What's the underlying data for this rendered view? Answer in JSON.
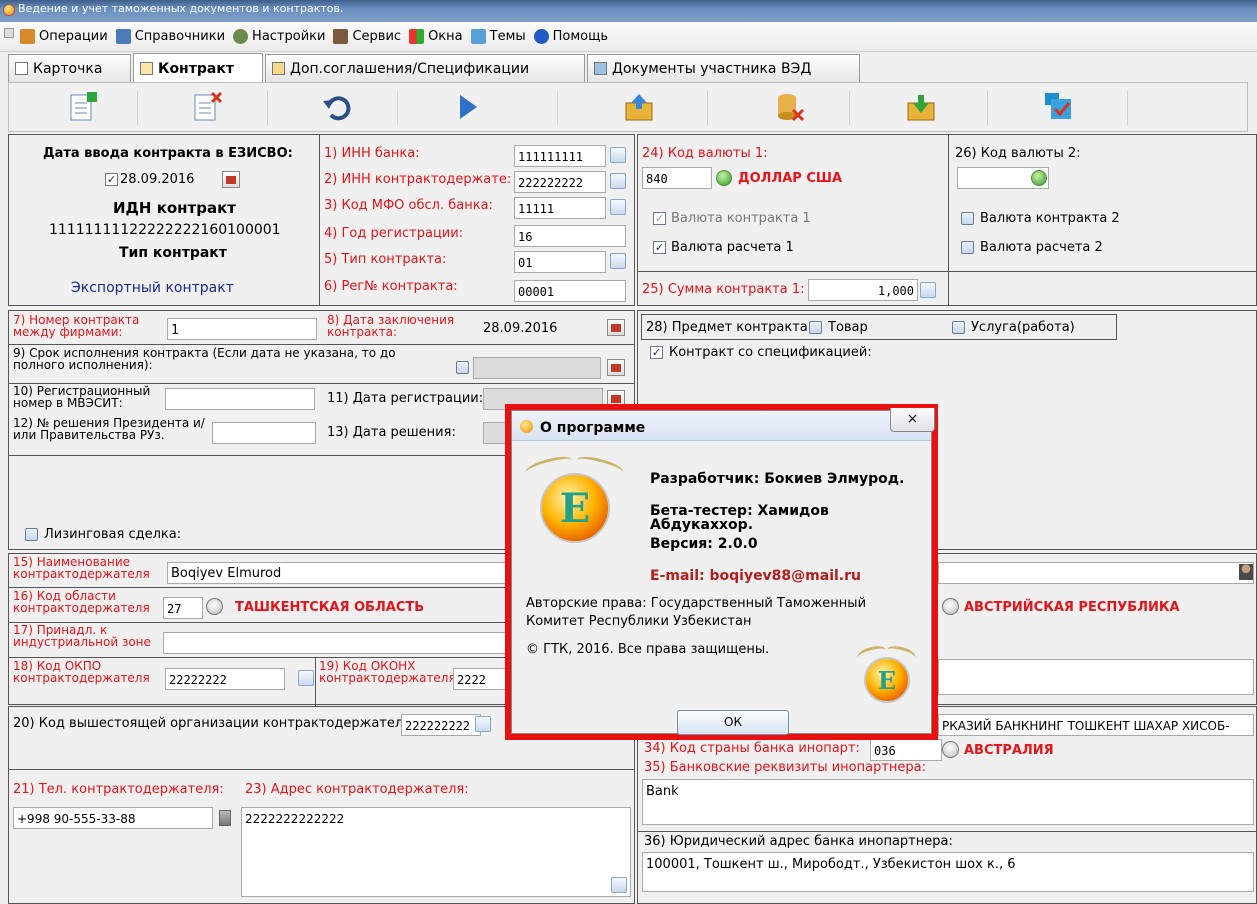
{
  "window": {
    "title": "Ведение и учет таможенных документов и контрактов."
  },
  "menu": [
    "Операции",
    "Справочники",
    "Настройки",
    "Сервис",
    "Окна",
    "Темы",
    "Помощь"
  ],
  "tabs": [
    "Карточка",
    "Контракт",
    "Доп.соглашения/Спецификации",
    "Документы участника ВЭД"
  ],
  "header": {
    "entry_date_label": "Дата ввода контракта в ЕЗИСВО:",
    "entry_date": "28.09.2016",
    "idn_label": "ИДН контракт",
    "idn": "11111111122222222160100001",
    "type_label": "Тип контракт",
    "type_value": "Экспортный контракт"
  },
  "bank": {
    "inn_bank_label": "1) ИНН банка:",
    "inn_bank": "111111111",
    "inn_holder_label": "2) ИНН контрактодержате:",
    "inn_holder": "222222222",
    "mfo_label": "3) Код МФО обсл. банка:",
    "mfo": "11111",
    "year_label": "4) Год регистрации:",
    "year": "16",
    "ctype_label": "5) Тип контракта:",
    "ctype": "01",
    "regno_label": "6) Рег№ контракта:",
    "regno": "00001"
  },
  "currency": {
    "code1_label": "24) Код валюты 1:",
    "code1": "840",
    "name1": "ДОЛЛАР США",
    "code2_label": "26) Код валюты 2:",
    "contract_cur1": "Валюта контракта 1",
    "settle_cur1": "Валюта расчета 1",
    "contract_cur2": "Валюта контракта 2",
    "settle_cur2": "Валюта расчета 2",
    "sum_label": "25) Сумма контракта 1:",
    "sum": "1,000"
  },
  "contract": {
    "num_label": "7) Номер контракта между фирмами:",
    "num": "1",
    "date_label": "8) Дата заключения контракта:",
    "date": "28.09.2016",
    "term_label": "9) Срок исполнения контракта (Если дата не указана, то до полного исполнения):",
    "mves_label": "10) Регистрационный номер в МВЭСИТ:",
    "regdate_label": "11) Дата регистрации:",
    "decree_label": "12) № решения Президента и/или Правительства РУз.",
    "decree_date_label": "13) Дата решения:",
    "subject_label": "28) Предмет контракта:",
    "goods": "Товар",
    "service": "Услуга(работа)",
    "spec": "Контракт со спецификацией:",
    "leasing": "Лизинговая сделка:"
  },
  "holder": {
    "name_label": "15) Наименование контрактодержателя",
    "name": "Boqiyev Elmurod",
    "region_label": "16) Код области контрактодержателя",
    "region_code": "27",
    "region_name": "ТАШКЕНТСКАЯ ОБЛАСТЬ",
    "zone_label": "17) Принадл. к индустриальной зоне",
    "okpo_label": "18) Код ОКПО контрактодержателя",
    "okpo": "22222222",
    "okonh_label": "19) Код ОКОНХ контрактодержателя:",
    "okonh": "2222",
    "parent_label": "20) Код вышестоящей организации контрактодержателя:",
    "parent": "222222222",
    "tel_label": "21) Тел. контрактодержателя:",
    "tel": "+998 90-555-33-88",
    "addr_label": "23) Адрес контрактодержателя:",
    "addr": "2222222222222"
  },
  "partner": {
    "country": "АВСТРИЙСКАЯ РЕСПУБЛИКА",
    "bank_name": "РКАЗИЙ БАНКНИНГ ТОШКЕНТ ШАХАР ХИСОБ-",
    "bank_country_label": "34) Код страны банка инопарт:",
    "bank_country_code": "036",
    "bank_country": "АВСТРАЛИЯ",
    "req_label": "35) Банковские реквизиты инопартнера:",
    "req": "Bank",
    "legal_label": "36) Юридический адрес банка инопартнера:",
    "legal": "100001, Тошкент ш., Мирободт., Узбекистон шох к., 6"
  },
  "about": {
    "title": "О программе",
    "close": "×",
    "developer": "Разработчик: Бокиев Элмурод.",
    "tester": "Бета-тестер: Хамидов Абдукаххор.",
    "version": "Версия: 2.0.0",
    "email": "E-mail: boqiyev88@mail.ru",
    "rights": "Авторские права: Государственный Таможенный Комитет Республики Узбекистан",
    "copyright": "© ГТК, 2016. Все права защищены.",
    "ok": "ОК",
    "logo_letter": "E"
  },
  "colors": {
    "label_red": "#e4141a",
    "dark_blue": "#1c2a8a",
    "highlight": "#e81010"
  }
}
